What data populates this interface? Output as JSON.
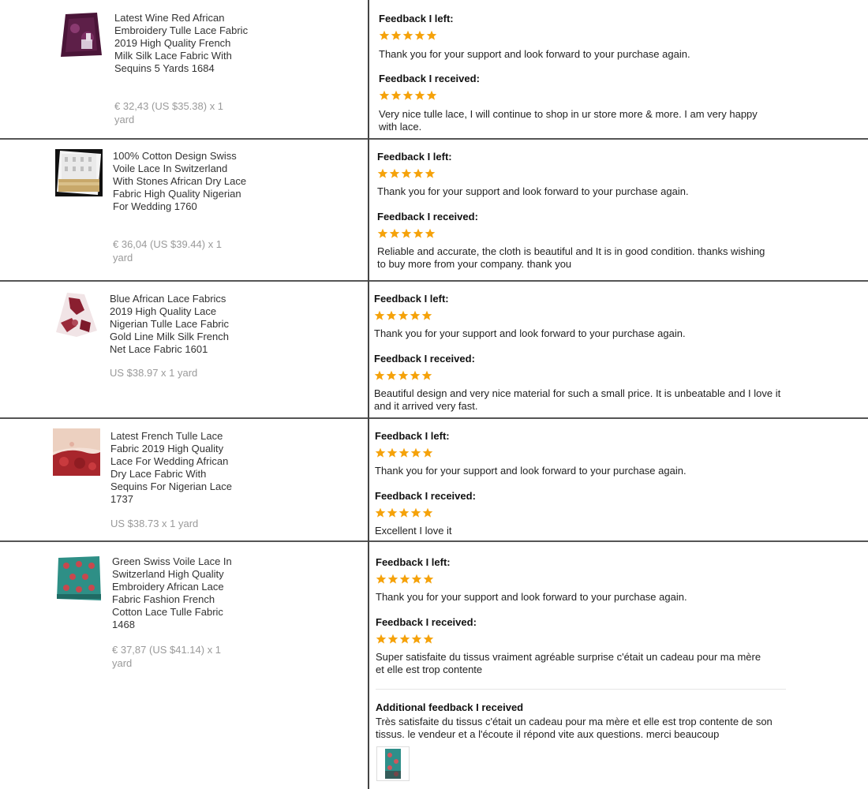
{
  "colors": {
    "star": "#f5a20a",
    "divider": "#555555",
    "price_text": "#9a9a9a"
  },
  "labels": {
    "left": "Feedback I left:",
    "received": "Feedback I received:",
    "additional": "Additional feedback I received"
  },
  "orders": [
    {
      "product_name": "Latest Wine Red African Embroidery Tulle Lace Fabric 2019 High Quality French Milk Silk Lace Fabric With Sequins 5 Yards 1684",
      "price": "€ 32,43 (US $35.38) x 1 yard",
      "thumb_icon": "wine-red-lace-fabric-thumbnail",
      "left_rating": 5,
      "left_text": "Thank you for your support and look forward to your purchase again.",
      "received_rating": 5,
      "received_text": "Very nice tulle lace, I will continue to shop in ur store more & more. I am very happy with lace."
    },
    {
      "product_name": "100% Cotton Design Swiss Voile Lace In Switzerland With Stones African Dry Lace Fabric High Quality Nigerian For Wedding 1760",
      "price": "€ 36,04 (US $39.44) x 1 yard",
      "thumb_icon": "white-gold-lace-fabric-thumbnail",
      "left_rating": 5,
      "left_text": "Thank you for your support and look forward to your purchase again.",
      "received_rating": 5,
      "received_text": "Reliable and accurate, the cloth is beautiful and It is in good condition. thanks wishing to buy more from your company. thank you"
    },
    {
      "product_name": "Blue African Lace Fabrics 2019 High Quality Lace Nigerian Tulle Lace Fabric Gold Line Milk Silk French Net Lace Fabric 1601",
      "price": "US $38.97 x 1 yard",
      "thumb_icon": "burgundy-lace-fabric-thumbnail",
      "left_rating": 5,
      "left_text": "Thank you for your support and look forward to your purchase again.",
      "received_rating": 5,
      "received_text": "Beautiful design and very nice material for such a small price. It is unbeatable and I love it and it arrived very fast."
    },
    {
      "product_name": "Latest French Tulle Lace Fabric 2019 High Quality Lace For Wedding African Dry Lace Fabric With Sequins For Nigerian Lace 1737",
      "price": "US $38.73 x 1 yard",
      "thumb_icon": "peach-red-lace-fabric-thumbnail",
      "left_rating": 5,
      "left_text": "Thank you for your support and look forward to your purchase again.",
      "received_rating": 5,
      "received_text": "Excellent I love it"
    },
    {
      "product_name": "Green Swiss Voile Lace In Switzerland High Quality Embroidery African Lace Fabric Fashion French Cotton Lace Tulle Fabric 1468",
      "price": "€ 37,87 (US $41.14) x 1 yard",
      "thumb_icon": "green-swiss-voile-fabric-thumbnail",
      "left_rating": 5,
      "left_text": "Thank you for your support and look forward to your purchase again.",
      "received_rating": 5,
      "received_text": "Super satisfaite du tissus vraiment agréable surprise c'était un cadeau pour ma mère et elle est trop contente"
    }
  ],
  "additional_feedback": {
    "text": "Très satisfaite du tissus c'était un cadeau pour ma mère et elle est trop contente de son tissus. le vendeur et a l'écoute il répond vite aux questions. merci beaucoup",
    "photo_icon": "buyer-photo-thumbnail"
  }
}
